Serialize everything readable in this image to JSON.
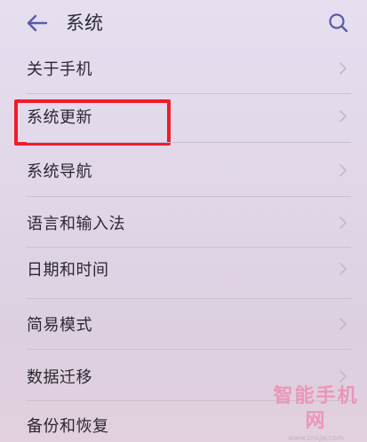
{
  "header": {
    "title": "系统",
    "back_icon": "arrow-left-icon",
    "search_icon": "search-icon"
  },
  "menu": {
    "items": [
      {
        "label": "关于手机"
      },
      {
        "label": "系统更新"
      },
      {
        "label": "系统导航"
      },
      {
        "label": "语言和输入法"
      },
      {
        "label": "日期和时间"
      },
      {
        "label": "简易模式"
      },
      {
        "label": "数据迁移"
      },
      {
        "label": "备份和恢复"
      }
    ],
    "highlighted_item": "系统更新"
  },
  "watermark": {
    "title": "智能手机网",
    "url": "www.znsjw.com"
  },
  "colors": {
    "accent": "#5a5aa8",
    "highlight": "#f01c2a",
    "watermark": "#ee8bb4"
  }
}
